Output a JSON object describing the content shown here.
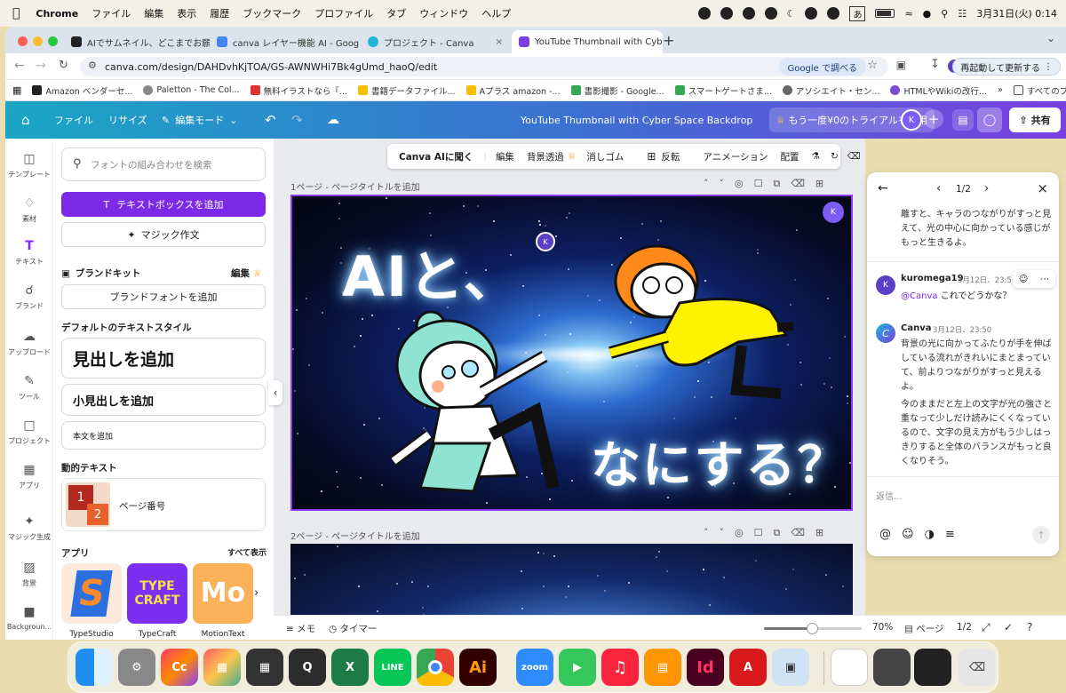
{
  "menubar": {
    "app": "Chrome",
    "items": [
      "ファイル",
      "編集",
      "表示",
      "履歴",
      "ブックマーク",
      "プロファイル",
      "タブ",
      "ウィンドウ",
      "ヘルプ"
    ],
    "ime": "あ",
    "battery": "",
    "datetime": "3月31日(火)  0:14"
  },
  "browser": {
    "tabs": [
      {
        "label": "AIでサムネイル、どこまでお願い",
        "active": false
      },
      {
        "label": "canva レイヤー機能 AI - Goog",
        "active": false
      },
      {
        "label": "プロジェクト - Canva",
        "active": false
      },
      {
        "label": "YouTube Thumbnail with Cyber",
        "active": true
      }
    ],
    "url": "canva.com/design/DAHDvhKjTOA/GS-AWNWHi7Bk4gUmd_haoQ/edit",
    "google_lens": "Google で調べる",
    "relaunch": "再起動して更新する",
    "bookmarks": [
      "Amazon ベンダーセ...",
      "Paletton - The Col...",
      "無料イラストなら「...",
      "書籍データファイル...",
      "Aプラス amazon -...",
      "書影撮影 - Google...",
      "スマートゲートさま...",
      "アソシエイト・セン...",
      "HTMLやWikiの改行..."
    ],
    "bookmarks_more": "»",
    "all_bookmarks": "すべてのブックマーク"
  },
  "canva_header": {
    "file": "ファイル",
    "resize": "リサイズ",
    "edit_mode": "編集モード",
    "title": "YouTube Thumbnail with Cyber Space Backdrop",
    "trial": "もう一度¥0のトライアルを利用",
    "avatar": "K",
    "share": "共有"
  },
  "rail": [
    {
      "label": "テンプレート",
      "icon": "template-icon"
    },
    {
      "label": "素材",
      "icon": "elements-icon"
    },
    {
      "label": "テキスト",
      "icon": "text-icon"
    },
    {
      "label": "ブランド",
      "icon": "brand-icon"
    },
    {
      "label": "アップロード",
      "icon": "upload-icon"
    },
    {
      "label": "ツール",
      "icon": "tools-icon"
    },
    {
      "label": "プロジェクト",
      "icon": "folder-icon"
    },
    {
      "label": "アプリ",
      "icon": "apps-icon"
    },
    {
      "label": "マジック生成",
      "icon": "magic-icon"
    },
    {
      "label": "背景",
      "icon": "background-icon"
    },
    {
      "label": "Backgroun...",
      "icon": "app-icon"
    }
  ],
  "panel": {
    "search_placeholder": "フォントの組み合わせを検索",
    "add_textbox": "テキストボックスを追加",
    "magic_write": "マジック作文",
    "brand_kit": "ブランドキット",
    "brand_edit": "編集",
    "brand_fonts": "ブランドフォントを追加",
    "default_styles": "デフォルトのテキストスタイル",
    "heading": "見出しを追加",
    "subheading": "小見出しを追加",
    "body": "本文を追加",
    "dynamic_text": "動的テキスト",
    "page_number": "ページ番号",
    "apps": "アプリ",
    "show_all": "すべて表示",
    "app_tiles": [
      "TypeStudio",
      "TypeCraft",
      "MotionText"
    ]
  },
  "toolbar": {
    "ask_ai": "Canva AIに聞く",
    "edit": "編集",
    "bg_remove": "背景透過",
    "eraser": "消しゴム",
    "flip": "反転",
    "animation": "アニメーション",
    "arrange": "配置"
  },
  "pages": {
    "p1_label": "1ページ - ページタイトルを追加",
    "p2_label": "2ページ - ページタイトルを追加",
    "headline_top": "AIと、",
    "headline_bottom": "なにする？",
    "badge": "K"
  },
  "comments": {
    "pager": "1/2",
    "prev_text": "離すと、キャラのつながりがすっと見えて、光の中心に向かっている感じがもっと生きるよ。",
    "c1_author": "kuromega19",
    "c1_date": "3月12日、23:5",
    "c1_mention": "@Canva",
    "c1_text": "これでどうかな？",
    "c2_author": "Canva",
    "c2_date": "3月12日、23:50",
    "c2_p1": "背景の光に向かってふたりが手を伸ばしている流れがきれいにまとまっていて、前よりつながりがすっと見えるよ。",
    "c2_p2": "今のままだと左上の文字が光の強さと重なって少しだけ読みにくくなっているので、文字の見え方がもう少しはっきりすると全体のバランスがもっと良くなりそう。",
    "reply_placeholder": "返信..."
  },
  "bottombar": {
    "notes": "メモ",
    "timer": "タイマー",
    "zoom": "70%",
    "pages_label": "ページ",
    "page_count": "1/2",
    "zoom_level": 0.7
  },
  "dock": [
    "Finder",
    "System Settings",
    "Creative Cloud",
    "Launchpad",
    "Calculator",
    "QuickTime",
    "Excel",
    "LINE",
    "Chrome",
    "Illustrator",
    "Zoom",
    "FaceTime",
    "Music",
    "Books",
    "InDesign",
    "Acrobat",
    "Preview"
  ]
}
